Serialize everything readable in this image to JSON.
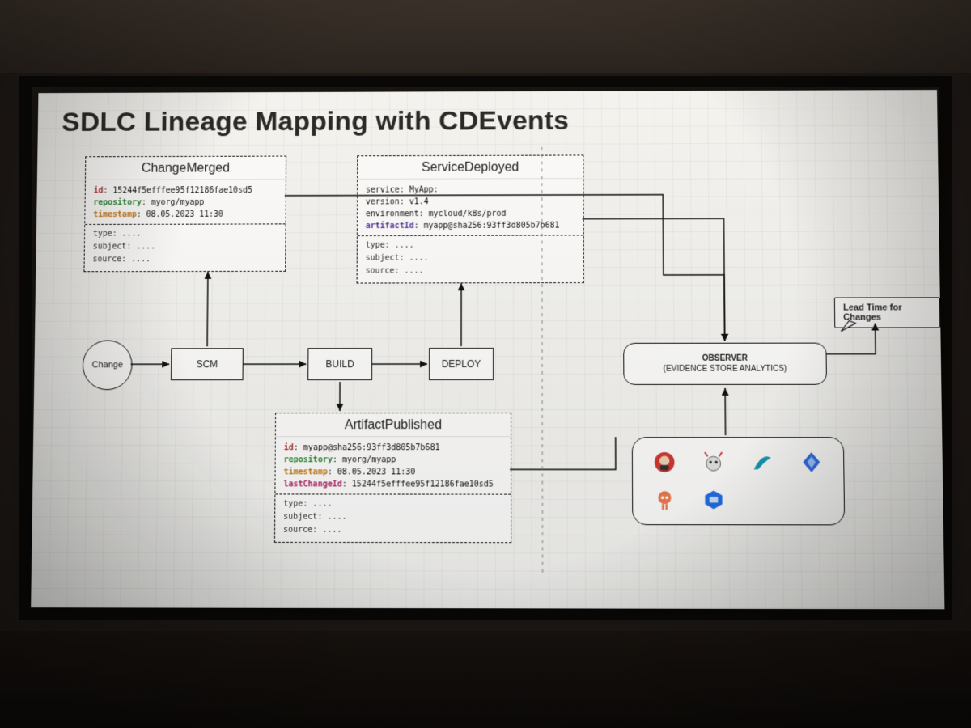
{
  "slide": {
    "title": "SDLC Lineage Mapping with CDEvents"
  },
  "pipeline": {
    "change": "Change",
    "scm": "SCM",
    "build": "BUILD",
    "deploy": "DEPLOY",
    "observer_line1": "OBSERVER",
    "observer_line2": "(EVIDENCE STORE ANALYTICS)",
    "callout": "Lead Time for Changes"
  },
  "events": {
    "changeMerged": {
      "title": "ChangeMerged",
      "id_label": "id",
      "id_value": "15244f5efffee95f12186fae10sd5",
      "repo_label": "repository",
      "repo_value": "myorg/myapp",
      "ts_label": "timestamp",
      "ts_value": "08.05.2023 11:30",
      "meta_type": "type: ....",
      "meta_subject": "subject: ....",
      "meta_source": "source: ...."
    },
    "serviceDeployed": {
      "title": "ServiceDeployed",
      "service_label": "service",
      "service_value": "MyApp:",
      "version_label": "version",
      "version_value": "v1.4",
      "env_label": "environment",
      "env_value": "mycloud/k8s/prod",
      "artid_label": "artifactId",
      "artid_value": "myapp@sha256:93ff3d805b7b681",
      "meta_type": "type: ....",
      "meta_subject": "subject: ....",
      "meta_source": "source: ...."
    },
    "artifactPublished": {
      "title": "ArtifactPublished",
      "id_label": "id",
      "id_value": "myapp@sha256:93ff3d805b7b681",
      "repo_label": "repository",
      "repo_value": "myorg/myapp",
      "ts_label": "timestamp",
      "ts_value": "08.05.2023 11:30",
      "lastch_label": "lastChangeId",
      "lastch_value": "15244f5efffee95f12186fae10sd5",
      "meta_type": "type: ....",
      "meta_subject": "subject: ....",
      "meta_source": "source: ...."
    }
  },
  "tools": {
    "names": [
      "jenkins",
      "tekton",
      "spinnaker",
      "flux",
      "argo",
      "harbor"
    ]
  }
}
